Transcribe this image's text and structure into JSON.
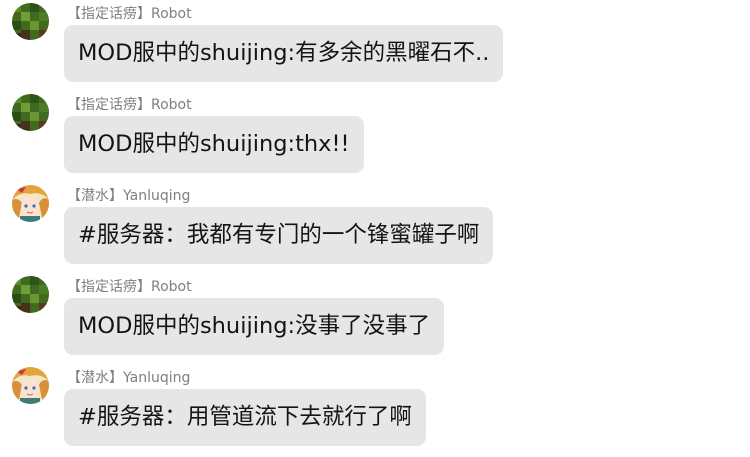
{
  "chat": {
    "messages": [
      {
        "avatar": "minecraft-grass-block-avatar",
        "sender": "【指定话痨】Robot",
        "text": "MOD服中的shuijing:有多余的黑曜石不.."
      },
      {
        "avatar": "minecraft-grass-block-avatar",
        "sender": "【指定话痨】Robot",
        "text": "MOD服中的shuijing:thx!!"
      },
      {
        "avatar": "anime-character-avatar",
        "sender": "【潜水】Yanluqing",
        "text": "#服务器：我都有专门的一个锋蜜罐子啊"
      },
      {
        "avatar": "minecraft-grass-block-avatar",
        "sender": "【指定话痨】Robot",
        "text": "MOD服中的shuijing:没事了没事了"
      },
      {
        "avatar": "anime-character-avatar",
        "sender": "【潜水】Yanluqing",
        "text": "#服务器：用管道流下去就行了啊"
      }
    ]
  },
  "colors": {
    "bubble_background": "#e6e6e6",
    "sender_text": "#7f7f7f",
    "message_text": "#141414"
  }
}
